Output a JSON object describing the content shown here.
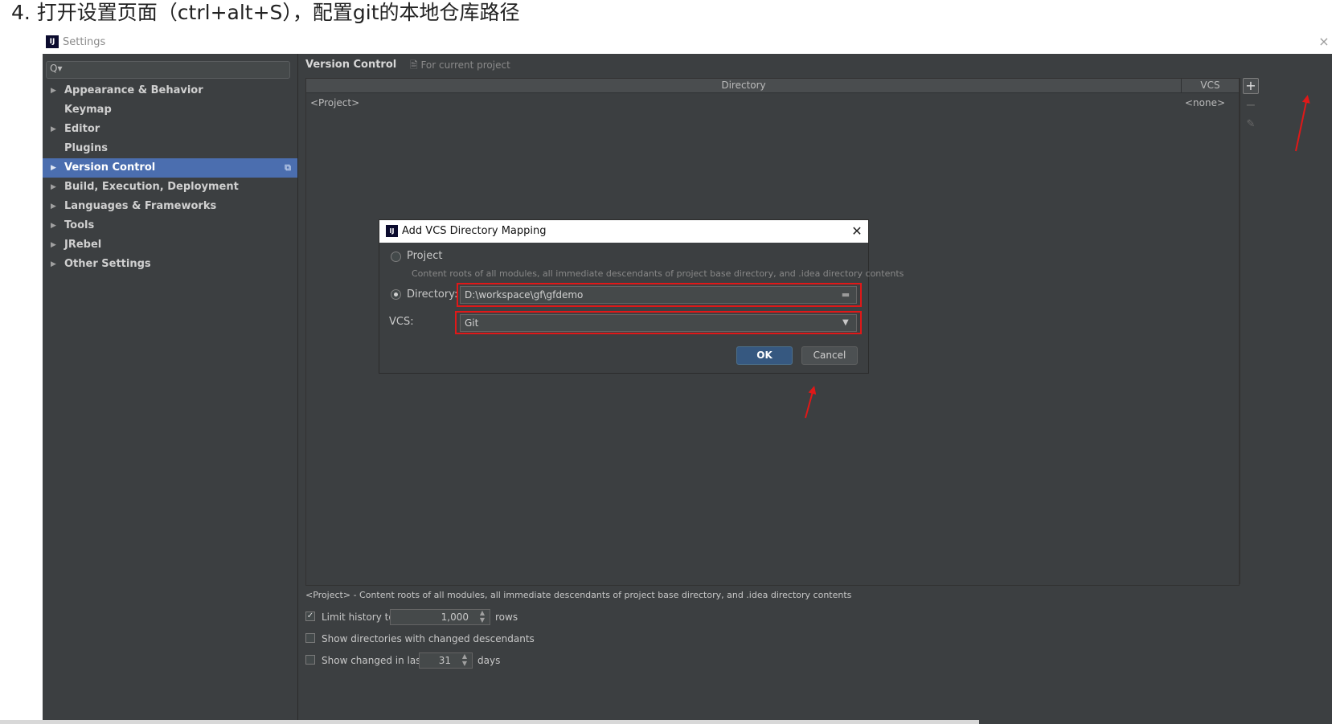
{
  "heading": "4. 打开设置页面（ctrl+alt+S），配置git的本地仓库路径",
  "window": {
    "title": "Settings",
    "app_icon": "IJ",
    "close": "×"
  },
  "search": {
    "value": "",
    "icon": "Q▾"
  },
  "sidebar": {
    "items": [
      {
        "label": "Appearance & Behavior",
        "arrow": "▶",
        "selected": false
      },
      {
        "label": "Keymap",
        "arrow": "",
        "selected": false
      },
      {
        "label": "Editor",
        "arrow": "▶",
        "selected": false
      },
      {
        "label": "Plugins",
        "arrow": "",
        "selected": false
      },
      {
        "label": "Version Control",
        "arrow": "▶",
        "selected": true
      },
      {
        "label": "Build, Execution, Deployment",
        "arrow": "▶",
        "selected": false
      },
      {
        "label": "Languages & Frameworks",
        "arrow": "▶",
        "selected": false
      },
      {
        "label": "Tools",
        "arrow": "▶",
        "selected": false
      },
      {
        "label": "JRebel",
        "arrow": "▶",
        "selected": false
      },
      {
        "label": "Other Settings",
        "arrow": "▶",
        "selected": false
      }
    ],
    "selected_color": "#4b6eaf"
  },
  "content": {
    "title": "Version Control",
    "scope": "🖹 For current project",
    "table": {
      "columns": [
        "Directory",
        "VCS"
      ],
      "rows": [
        {
          "directory": "<Project>",
          "vcs": "<none>"
        }
      ]
    },
    "tools": {
      "add": "+",
      "remove": "−",
      "edit": "✎"
    },
    "footnote": "<Project> - Content roots of all modules, all immediate descendants of project base directory, and .idea directory contents",
    "options": {
      "limit_history": {
        "label": "Limit history to:",
        "value": "1,000",
        "suffix": "rows",
        "checked": true,
        "check": "✓"
      },
      "show_dirs": {
        "label": "Show directories with changed descendants",
        "checked": false
      },
      "show_changed": {
        "label": "Show changed in last",
        "value": "31",
        "suffix": "days",
        "checked": false
      }
    }
  },
  "dialog": {
    "title": "Add VCS Directory Mapping",
    "icon": "IJ",
    "close": "✕",
    "project_option": {
      "label": "Project",
      "description": "Content roots of all modules, all immediate descendants of project base directory, and .idea directory contents",
      "selected": false
    },
    "directory_option": {
      "label": "Directory:",
      "value": "D:\\workspace\\gf\\gfdemo",
      "selected": true
    },
    "vcs": {
      "label": "VCS:",
      "value": "Git"
    },
    "ok": "OK",
    "cancel": "Cancel",
    "highlight_color": "#e01818"
  }
}
